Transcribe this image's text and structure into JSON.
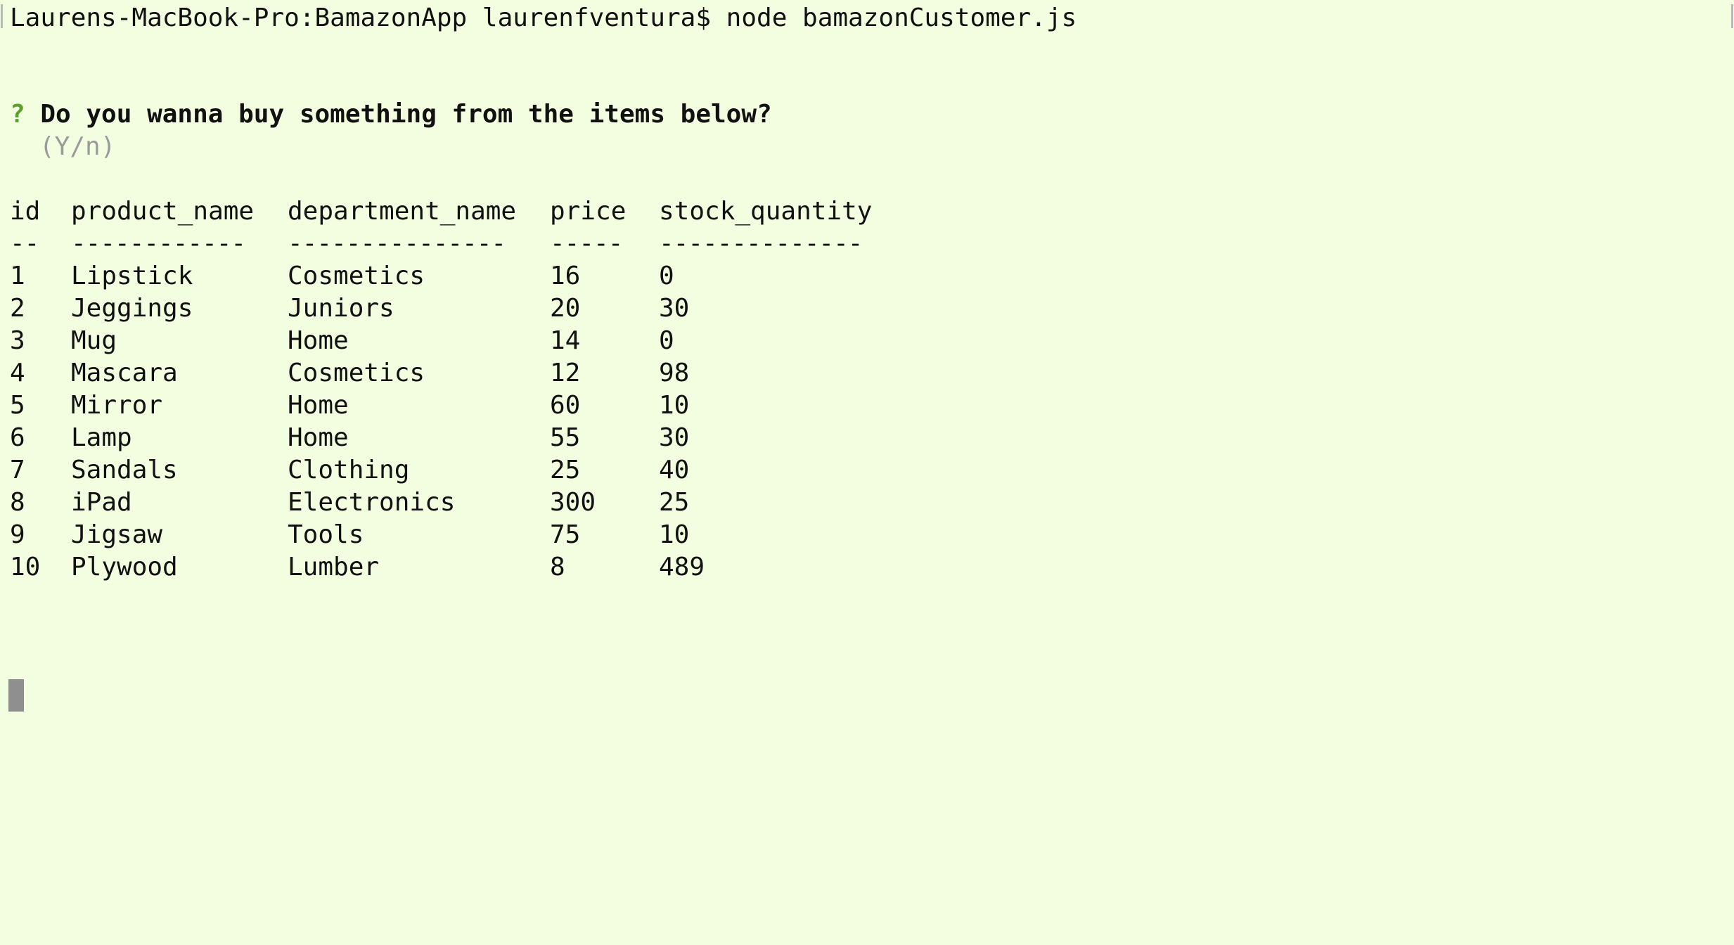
{
  "terminal": {
    "prompt": "Laurens-MacBook-Pro:BamazonApp laurenfventura$ node bamazonCustomer.js",
    "question_mark": "?",
    "question": " Do you wanna buy something from the items below?",
    "hint": "(Y/n)",
    "colors": {
      "background": "#f3fde0",
      "text": "#111111",
      "question_mark": "#5aa02c",
      "hint": "#9a9a9a",
      "cursor": "#8f8f8f"
    }
  },
  "table": {
    "headers": [
      "id",
      "product_name",
      "department_name",
      "price",
      "stock_quantity"
    ],
    "separators": [
      "--",
      "------------",
      "---------------",
      "-----",
      "--------------"
    ],
    "rows": [
      [
        "1",
        "Lipstick",
        "Cosmetics",
        "16",
        "0"
      ],
      [
        "2",
        "Jeggings",
        "Juniors",
        "20",
        "30"
      ],
      [
        "3",
        "Mug",
        "Home",
        "14",
        "0"
      ],
      [
        "4",
        "Mascara",
        "Cosmetics",
        "12",
        "98"
      ],
      [
        "5",
        "Mirror",
        "Home",
        "60",
        "10"
      ],
      [
        "6",
        "Lamp",
        "Home",
        "55",
        "30"
      ],
      [
        "7",
        "Sandals",
        "Clothing",
        "25",
        "40"
      ],
      [
        "8",
        "iPad",
        "Electronics",
        "300",
        "25"
      ],
      [
        "9",
        "Jigsaw",
        "Tools",
        "75",
        "10"
      ],
      [
        "10",
        "Plywood",
        "Lumber",
        "8",
        "489"
      ]
    ]
  }
}
